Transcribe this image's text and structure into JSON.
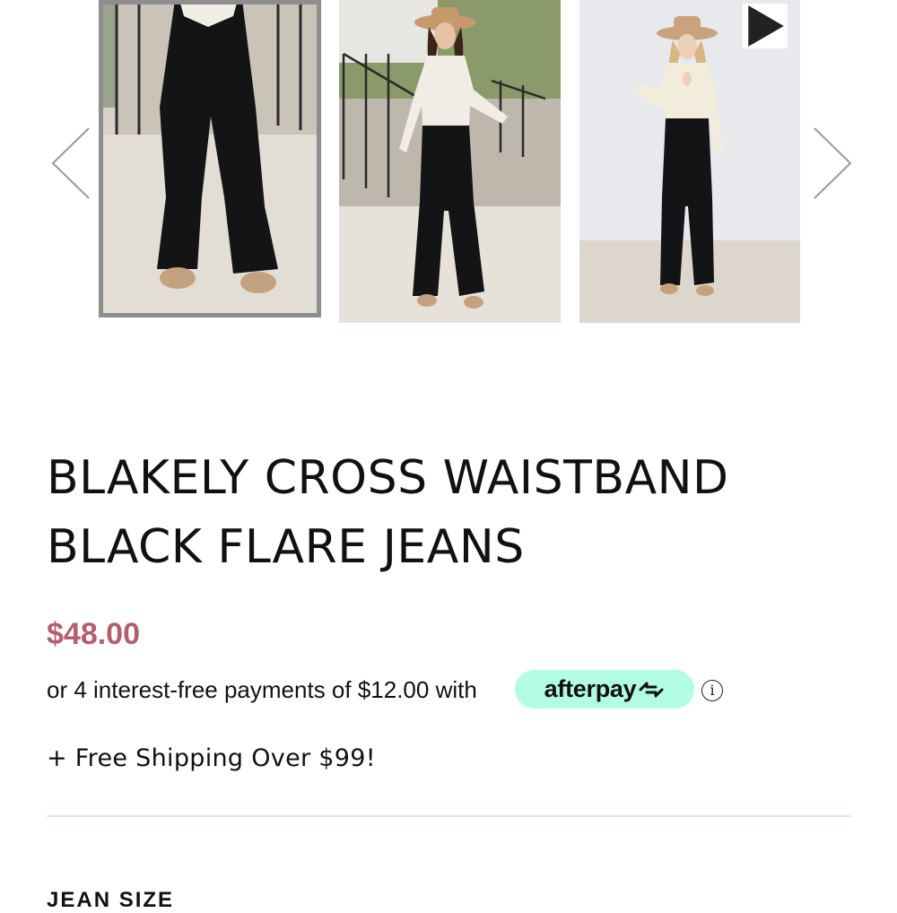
{
  "carousel": {
    "images": [
      {
        "alt": "Black flare jeans front view on steps",
        "selected": true
      },
      {
        "alt": "Model in white top, hat and black flare jeans",
        "selected": false
      },
      {
        "alt": "Model in cream keyhole top and black flare jeans video",
        "selected": false
      }
    ],
    "prev_icon": "chevron-left-icon",
    "next_icon": "chevron-right-icon",
    "play_icon": "play-icon"
  },
  "product": {
    "title_line1": "BLAKELY CROSS WAISTBAND",
    "title_line2": "BLACK FLARE JEANS",
    "price": "$48.00",
    "installment_text": "or 4 interest-free payments of $12.00 with",
    "afterpay_label": "afterpay",
    "info_symbol": "i",
    "shipping_note": "+ Free Shipping Over $99!",
    "size_heading": "JEAN SIZE"
  },
  "colors": {
    "price": "#b35f6d",
    "afterpay_mint": "#b2fce4",
    "divider": "#f6d9df",
    "selected_border": "#8e8e8e"
  }
}
